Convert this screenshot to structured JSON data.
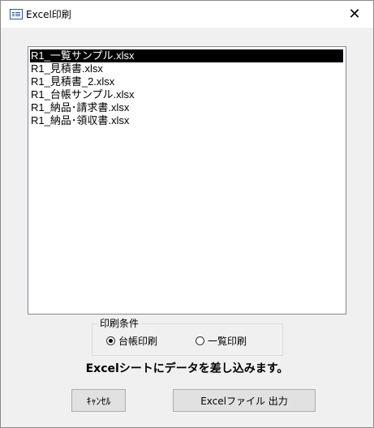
{
  "window": {
    "title": "Excel印刷",
    "close_glyph": "✕"
  },
  "file_list": {
    "items": [
      {
        "label": "R1_一覧サンプル.xlsx",
        "selected": true
      },
      {
        "label": "R1_見積書.xlsx",
        "selected": false
      },
      {
        "label": "R1_見積書_2.xlsx",
        "selected": false
      },
      {
        "label": "R1_台帳サンプル.xlsx",
        "selected": false
      },
      {
        "label": "R1_納品･請求書.xlsx",
        "selected": false
      },
      {
        "label": "R1_納品･領収書.xlsx",
        "selected": false
      }
    ]
  },
  "print_condition": {
    "label": "印刷条件",
    "options": [
      {
        "label": "台帳印刷",
        "checked": true
      },
      {
        "label": "一覧印刷",
        "checked": false
      }
    ]
  },
  "message": "Excelシートにデータを差し込みます。",
  "buttons": {
    "cancel": "ｷｬﾝｾﾙ",
    "output": "Excelファイル 出力"
  }
}
